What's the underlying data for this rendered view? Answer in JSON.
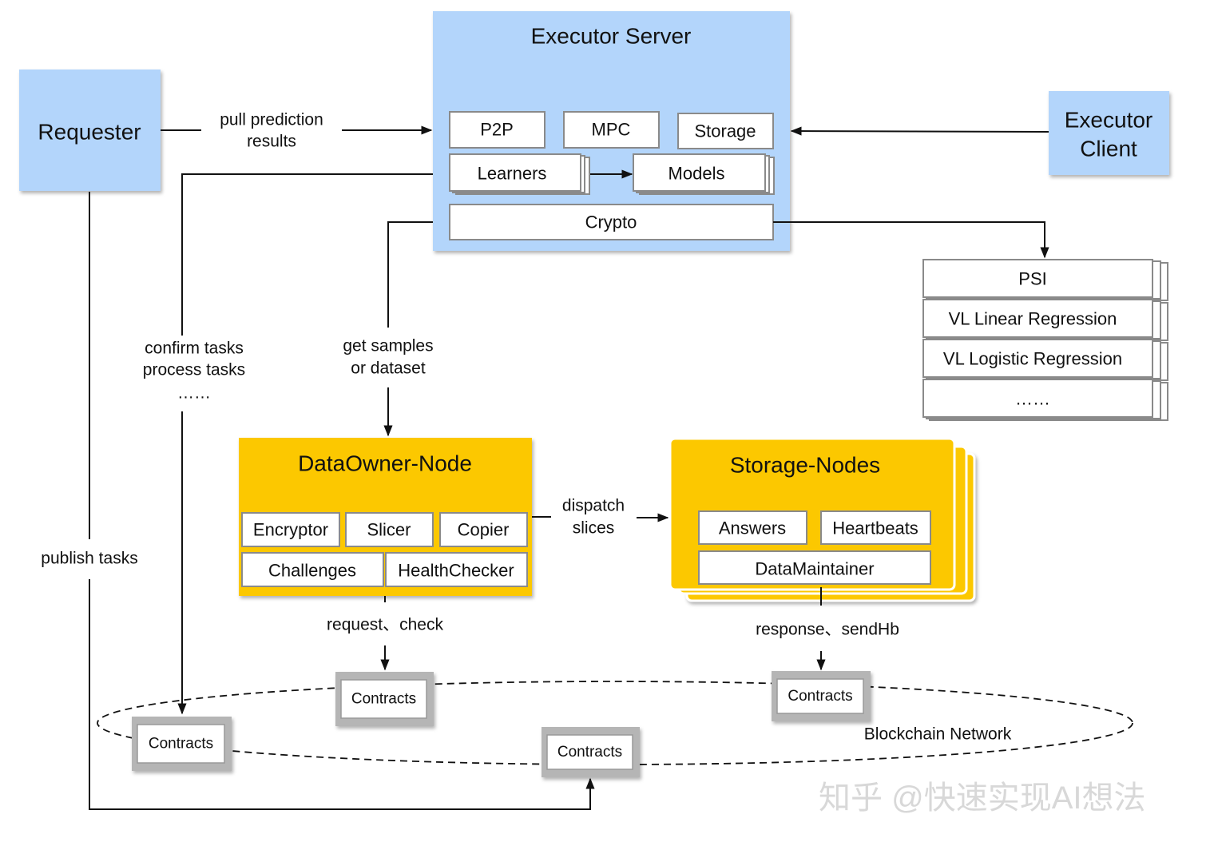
{
  "colors": {
    "blue": "#b3d5fb",
    "yellow": "#fcc800",
    "contract_gray": "#b5b5b5",
    "watermark": "#d8d8d8"
  },
  "requester": {
    "label": "Requester"
  },
  "executor_server": {
    "title": "Executor Server",
    "modules": {
      "p2p": "P2P",
      "mpc": "MPC",
      "storage": "Storage",
      "learners": "Learners",
      "models": "Models",
      "crypto": "Crypto"
    }
  },
  "executor_client": {
    "line1": "Executor",
    "line2": "Client"
  },
  "crypto_algorithms": [
    "PSI",
    "VL Linear Regression",
    "VL Logistic Regression",
    "……"
  ],
  "dataowner_node": {
    "title": "DataOwner-Node",
    "modules": {
      "encryptor": "Encryptor",
      "slicer": "Slicer",
      "copier": "Copier",
      "challenges": "Challenges",
      "healthchecker": "HealthChecker"
    }
  },
  "storage_nodes": {
    "title": "Storage-Nodes",
    "modules": {
      "answers": "Answers",
      "heartbeats": "Heartbeats",
      "datamaintainer": "DataMaintainer"
    }
  },
  "edges": {
    "pull_results": {
      "line1": "pull prediction",
      "line2": "results"
    },
    "confirm_tasks": {
      "line1": "confirm tasks",
      "line2": "process tasks",
      "line3": "……"
    },
    "get_samples": {
      "line1": "get samples",
      "line2": "or dataset"
    },
    "publish_tasks": "publish tasks",
    "dispatch_slices": {
      "line1": "dispatch",
      "line2": "slices"
    },
    "request_check": "request、check",
    "response_sendhb": "response、sendHb"
  },
  "blockchain": {
    "label": "Blockchain Network",
    "contracts": [
      "Contracts",
      "Contracts",
      "Contracts",
      "Contracts"
    ]
  },
  "watermark": "知乎 @快速实现AI想法"
}
